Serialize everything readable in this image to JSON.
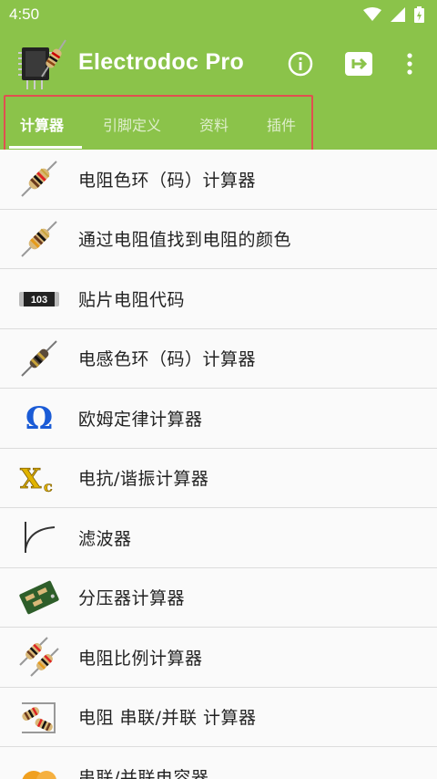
{
  "status_bar": {
    "time": "4:50"
  },
  "app_bar": {
    "title": "Electrodoc Pro",
    "actions": [
      "info-icon",
      "exit-icon",
      "more-vert-icon"
    ]
  },
  "tabs": [
    {
      "label": "计算器",
      "active": true
    },
    {
      "label": "引脚定义",
      "active": false
    },
    {
      "label": "资料",
      "active": false
    },
    {
      "label": "插件",
      "active": false
    }
  ],
  "list": {
    "items": [
      {
        "label": "电阻色环（码）计算器",
        "icon": "resistor-icon"
      },
      {
        "label": "通过电阻值找到电阻的颜色",
        "icon": "resistor-icon"
      },
      {
        "label": "贴片电阻代码",
        "icon": "smd-resistor-icon",
        "icon_text": "103"
      },
      {
        "label": "电感色环（码）计算器",
        "icon": "inductor-icon"
      },
      {
        "label": "欧姆定律计算器",
        "icon": "omega-icon",
        "icon_text": "Ω"
      },
      {
        "label": "电抗/谐振计算器",
        "icon": "xc-icon",
        "icon_text": "X",
        "icon_sub": "c"
      },
      {
        "label": "滤波器",
        "icon": "filter-curve-icon"
      },
      {
        "label": "分压器计算器",
        "icon": "pcb-icon"
      },
      {
        "label": "电阻比例计算器",
        "icon": "resistor-pair-icon"
      },
      {
        "label": "电阻 串联/并联 计算器",
        "icon": "resistor-network-icon"
      },
      {
        "label": "串联/并联电容器",
        "icon": "capacitor-icon"
      }
    ]
  },
  "colors": {
    "primary": "#8bc34a",
    "highlight": "#e05050",
    "divider": "#dcdcdc"
  }
}
